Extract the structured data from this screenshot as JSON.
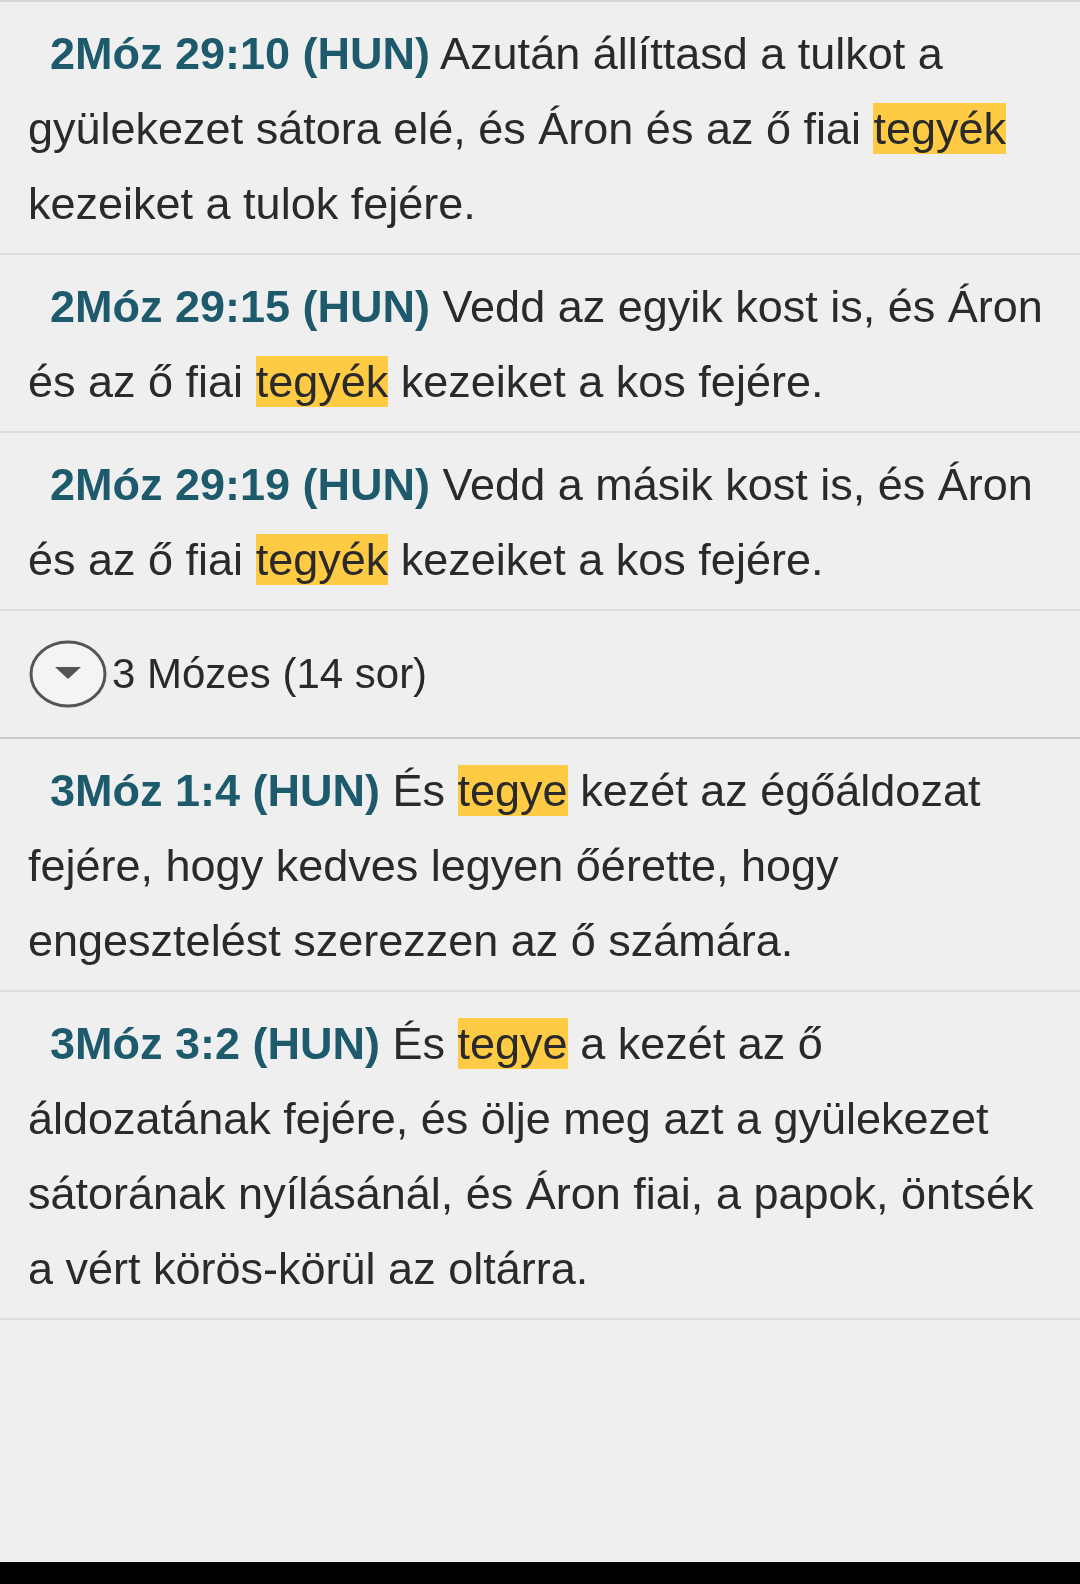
{
  "items": [
    {
      "kind": "verse",
      "ref": "2Móz 29:10 (HUN)",
      "before": "Azután állíttasd a tulkot a gyülekezet sátora elé, és Áron és az ő fiai",
      "match": "tegyék",
      "after": "kezeiket a tulok fejére."
    },
    {
      "kind": "verse",
      "ref": "2Móz 29:15 (HUN)",
      "before": "Vedd az egyik kost is, és Áron és az ő fiai",
      "match": "tegyék",
      "after": "kezeiket a kos fejére."
    },
    {
      "kind": "verse",
      "ref": "2Móz 29:19 (HUN)",
      "before": "Vedd a másik kost is, és Áron és az ő fiai",
      "match": "tegyék",
      "after": "kezeiket a kos fejére."
    },
    {
      "kind": "group",
      "label": "3 Mózes (14 sor)"
    },
    {
      "kind": "verse",
      "ref": "3Móz 1:4 (HUN)",
      "before": "És",
      "match": "tegye",
      "after": "kezét az égőáldozat fejére, hogy kedves legyen őérette, hogy engesztelést szerezzen az ő számára."
    },
    {
      "kind": "verse",
      "ref": "3Móz 3:2 (HUN)",
      "before": "És",
      "match": "tegye",
      "after": "a kezét az ő áldozatának fejére, és ölje meg azt a gyülekezet sátorának nyílásánál, és Áron fiai, a papok, öntsék a vért körös-körül az oltárra."
    }
  ]
}
